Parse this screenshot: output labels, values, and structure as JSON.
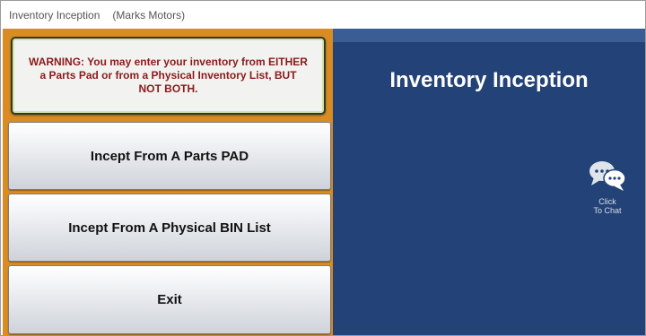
{
  "titlebar": {
    "app_title": "Inventory Inception",
    "company": "(Marks Motors)"
  },
  "warning": {
    "text": "WARNING:  You may enter your inventory from EITHER a Parts Pad or from a Physical Inventory List, BUT NOT BOTH."
  },
  "buttons": {
    "parts_pad": "Incept From A Parts PAD",
    "bin_list": "Incept From A Physical BIN List",
    "exit": "Exit"
  },
  "main": {
    "title": "Inventory Inception"
  },
  "chat": {
    "line1": "Click",
    "line2": "To Chat",
    "icon": "chat-bubbles-icon"
  },
  "colors": {
    "left_panel": "#d98c22",
    "right_panel": "#234277",
    "warning_text": "#8b1a1a"
  }
}
